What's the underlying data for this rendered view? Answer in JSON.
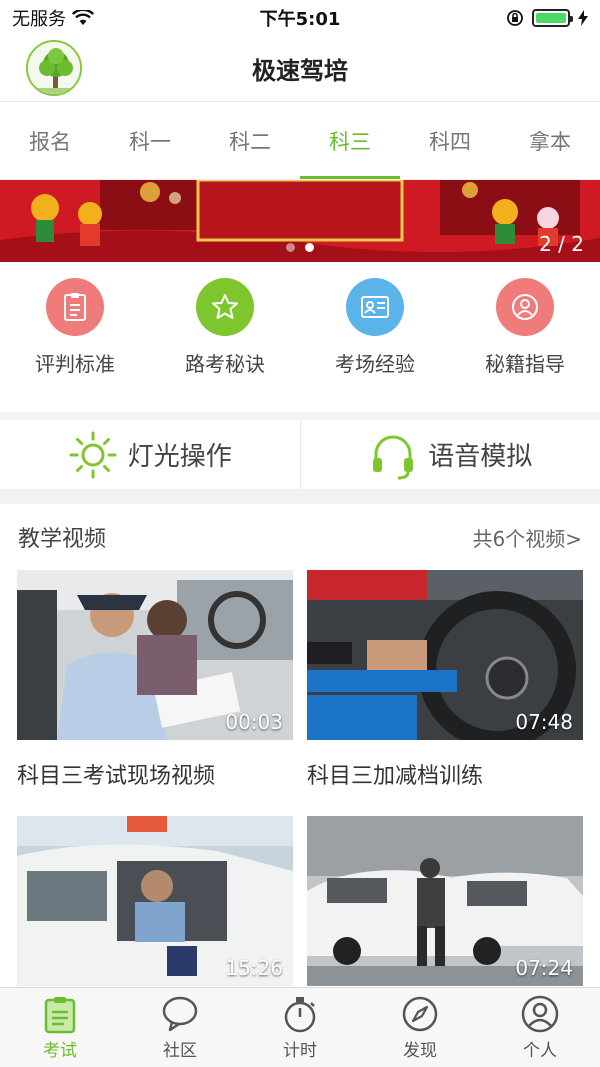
{
  "status_bar": {
    "carrier": "无服务",
    "time": "下午5:01"
  },
  "header": {
    "title": "极速驾培"
  },
  "tabs": [
    {
      "label": "报名",
      "active": false
    },
    {
      "label": "科一",
      "active": false
    },
    {
      "label": "科二",
      "active": false
    },
    {
      "label": "科三",
      "active": true
    },
    {
      "label": "科四",
      "active": false
    },
    {
      "label": "拿本",
      "active": false
    }
  ],
  "banner": {
    "counter": "2 / 2",
    "current_slide": 2,
    "total_slides": 2
  },
  "grid": [
    {
      "label": "评判标准",
      "icon": "clipboard-icon",
      "color": "#f07b7b"
    },
    {
      "label": "路考秘诀",
      "icon": "star-icon",
      "color": "#7ec62e"
    },
    {
      "label": "考场经验",
      "icon": "id-card-icon",
      "color": "#5ab4ea"
    },
    {
      "label": "秘籍指导",
      "icon": "user-icon",
      "color": "#f07b7b"
    }
  ],
  "features": [
    {
      "label": "灯光操作",
      "icon": "sun-icon"
    },
    {
      "label": "语音模拟",
      "icon": "headphones-icon"
    }
  ],
  "videos": {
    "section_title": "教学视频",
    "count_text": "共6个视频>",
    "items": [
      {
        "title": "科目三考试现场视频",
        "duration": "00:03"
      },
      {
        "title": "科目三加减档训练",
        "duration": "07:48"
      },
      {
        "title": "",
        "duration": "15:26"
      },
      {
        "title": "",
        "duration": "07:24"
      }
    ]
  },
  "bottom_nav": [
    {
      "label": "考试",
      "icon": "clipboard-icon",
      "active": true
    },
    {
      "label": "社区",
      "icon": "chat-bubble-icon",
      "active": false
    },
    {
      "label": "计时",
      "icon": "stopwatch-icon",
      "active": false
    },
    {
      "label": "发现",
      "icon": "compass-icon",
      "active": false
    },
    {
      "label": "个人",
      "icon": "user-icon",
      "active": false
    }
  ],
  "colors": {
    "accent": "#6bbd2f",
    "banner_red": "#d81e27"
  }
}
